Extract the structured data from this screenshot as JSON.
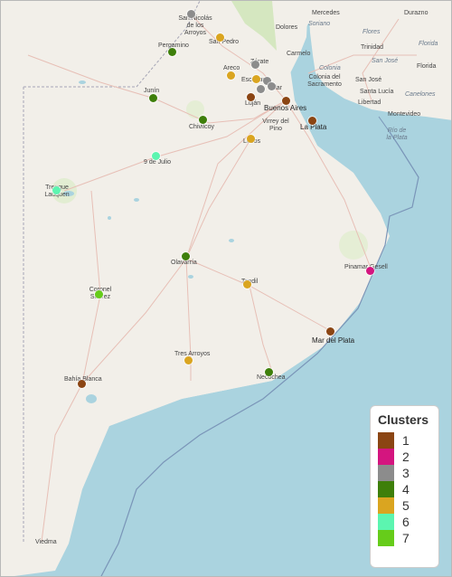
{
  "legend": {
    "title": "Clusters",
    "items": [
      {
        "label": "1",
        "color": "#8B4513"
      },
      {
        "label": "2",
        "color": "#D4157F"
      },
      {
        "label": "3",
        "color": "#8C8C8C"
      },
      {
        "label": "4",
        "color": "#3E7F0A"
      },
      {
        "label": "5",
        "color": "#DAA520"
      },
      {
        "label": "6",
        "color": "#5CF5B0"
      },
      {
        "label": "7",
        "color": "#66CC1A"
      }
    ]
  },
  "labels": {
    "san_nicolas": "San Nicolás de los Arroyos",
    "pergamino": "Pergamino",
    "san_pedro": "San Pedro",
    "zarate": "Zárate",
    "areco": "Areco",
    "escobar": "Escobar",
    "pilar": "Pilar",
    "lujan": "Luján",
    "buenos_aires": "Buenos Aires",
    "junin": "Junín",
    "chivilcoy": "Chivilcoy",
    "virrey": "Virrey del Pino",
    "la_plata": "La Plata",
    "lobos": "Lobos",
    "nueve_julio": "9 de Julio",
    "trenque": "Trenque Lauquen",
    "olavarria": "Olavarría",
    "tandil": "Tandil",
    "pinamar": "Pinamar",
    "gesell": "Gesell",
    "coronel": "Coronel Suárez",
    "mdp": "Mar del Plata",
    "tres_arroyos": "Tres Arroyos",
    "necochea": "Necochea",
    "bahia": "Bahía Blanca",
    "viedma": "Viedma",
    "mercedes": "Mercedes",
    "dolores": "Dolores",
    "soriano": "Soriano",
    "carmelo": "Carmelo",
    "colonia_dept": "Colonia",
    "colonia_city": "Colonia del Sacramento",
    "san_jose": "San José",
    "santa_lucia": "Santa Lucía",
    "libertad": "Libertad",
    "montevideo": "Montevideo",
    "durazno": "Durazno",
    "flores": "Flores",
    "florida": "Florida",
    "canelones": "Canelones",
    "san_jose_dept": "San José",
    "trinidad": "Trinidad",
    "rio_plata": "Río de la Plata"
  },
  "points": [
    {
      "cluster": "3"
    },
    {
      "cluster": "5"
    },
    {
      "cluster": "4"
    },
    {
      "cluster": "3"
    },
    {
      "cluster": "5"
    },
    {
      "cluster": "3"
    },
    {
      "cluster": "5"
    },
    {
      "cluster": "3"
    },
    {
      "cluster": "3"
    },
    {
      "cluster": "1"
    },
    {
      "cluster": "1"
    },
    {
      "cluster": "4"
    },
    {
      "cluster": "4"
    },
    {
      "cluster": "1"
    },
    {
      "cluster": "5"
    },
    {
      "cluster": "6"
    },
    {
      "cluster": "6"
    },
    {
      "cluster": "4"
    },
    {
      "cluster": "5"
    },
    {
      "cluster": "2"
    },
    {
      "cluster": "7"
    },
    {
      "cluster": "1"
    },
    {
      "cluster": "5"
    },
    {
      "cluster": "4"
    },
    {
      "cluster": "1"
    }
  ]
}
